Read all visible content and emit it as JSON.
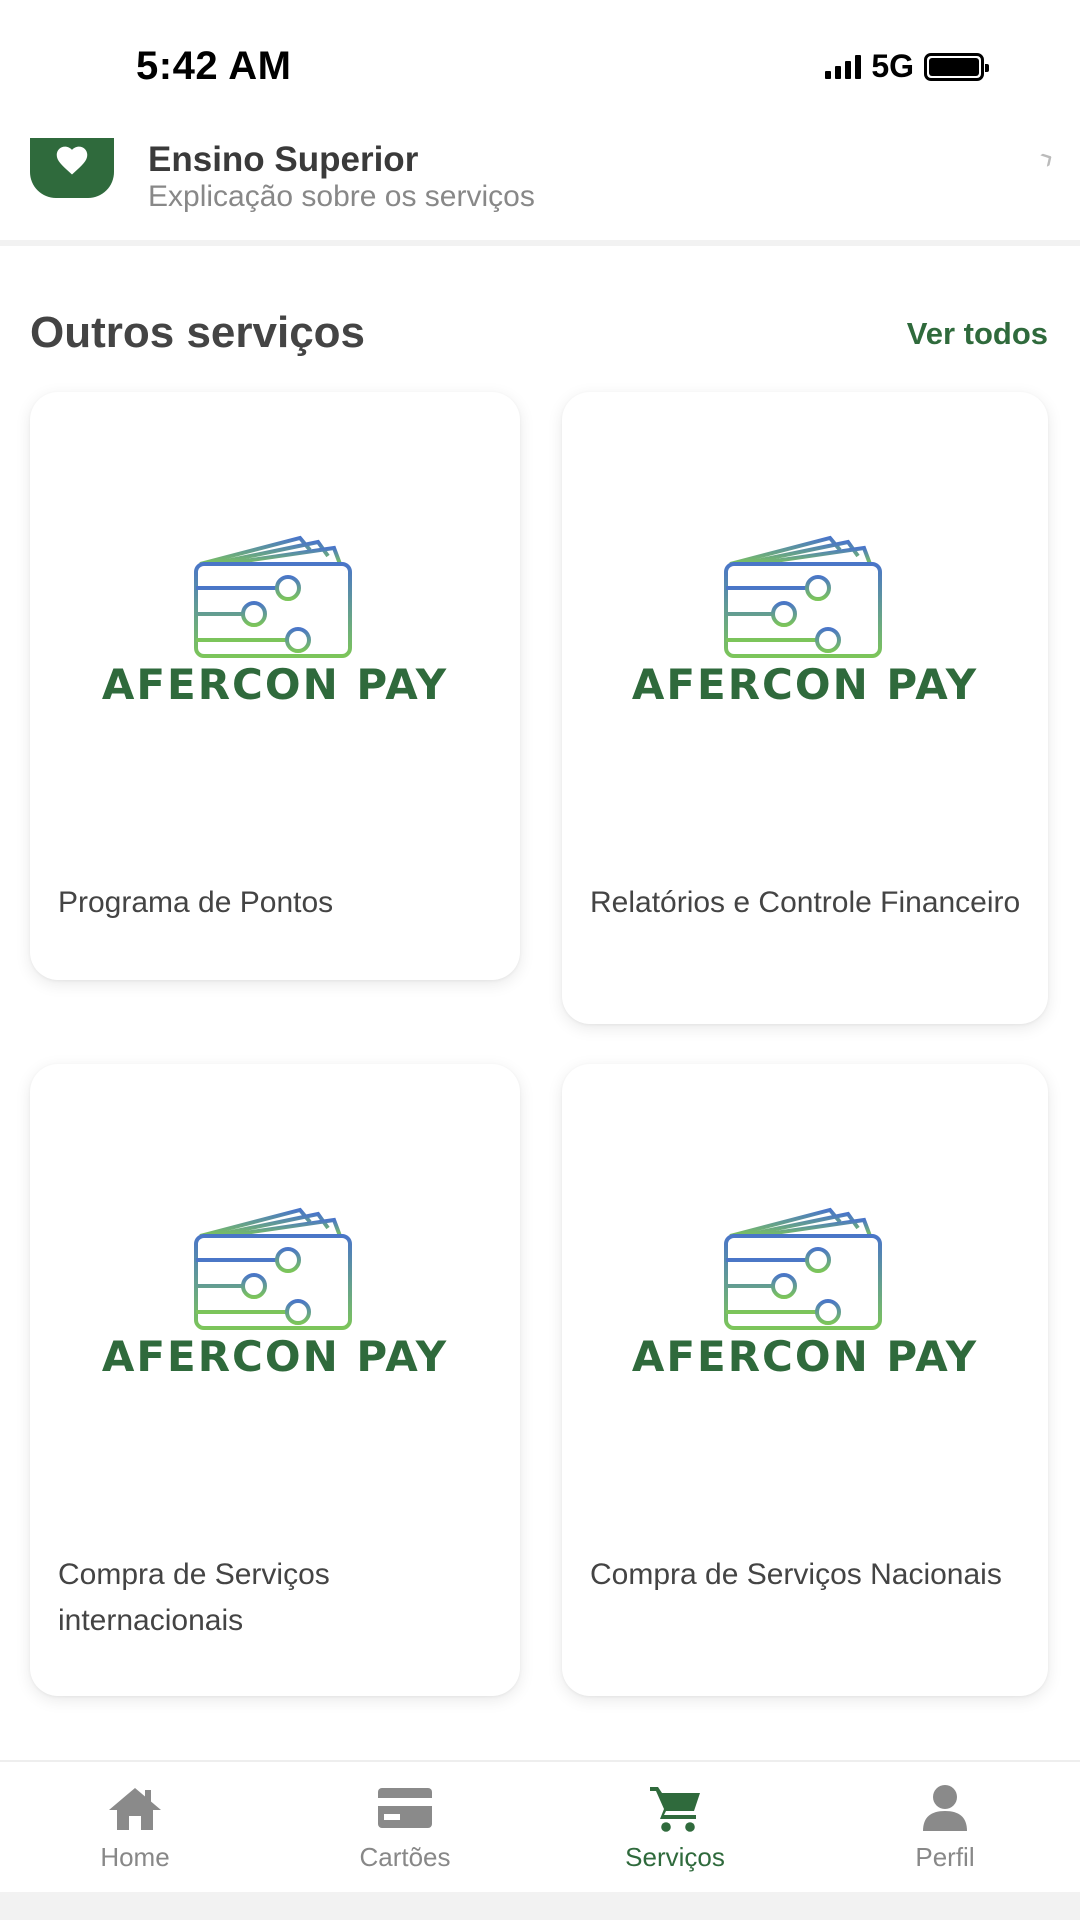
{
  "status_bar": {
    "time": "5:42 AM",
    "network": "5G"
  },
  "header_item": {
    "title": "Ensino Superior",
    "subtitle": "Explicação sobre os serviços",
    "icon": "heart-icon"
  },
  "section": {
    "title": "Outros serviços",
    "see_all_label": "Ver todos"
  },
  "cards": [
    {
      "brand": "AFERCON PAY",
      "label": "Programa de Pontos"
    },
    {
      "brand": "AFERCON PAY",
      "label": "Relatórios e Controle Financeiro"
    },
    {
      "brand": "AFERCON PAY",
      "label": "Compra de Serviços internacionais"
    },
    {
      "brand": "AFERCON PAY",
      "label": "Compra de Serviços Nacionais"
    }
  ],
  "bottom_nav": {
    "items": [
      {
        "label": "Home",
        "icon": "home-icon"
      },
      {
        "label": "Cartões",
        "icon": "credit-card-icon"
      },
      {
        "label": "Serviços",
        "icon": "cart-icon",
        "active": true
      },
      {
        "label": "Perfil",
        "icon": "user-icon"
      }
    ]
  },
  "colors": {
    "brand_green": "#2f6a3c",
    "inactive": "#888888"
  }
}
